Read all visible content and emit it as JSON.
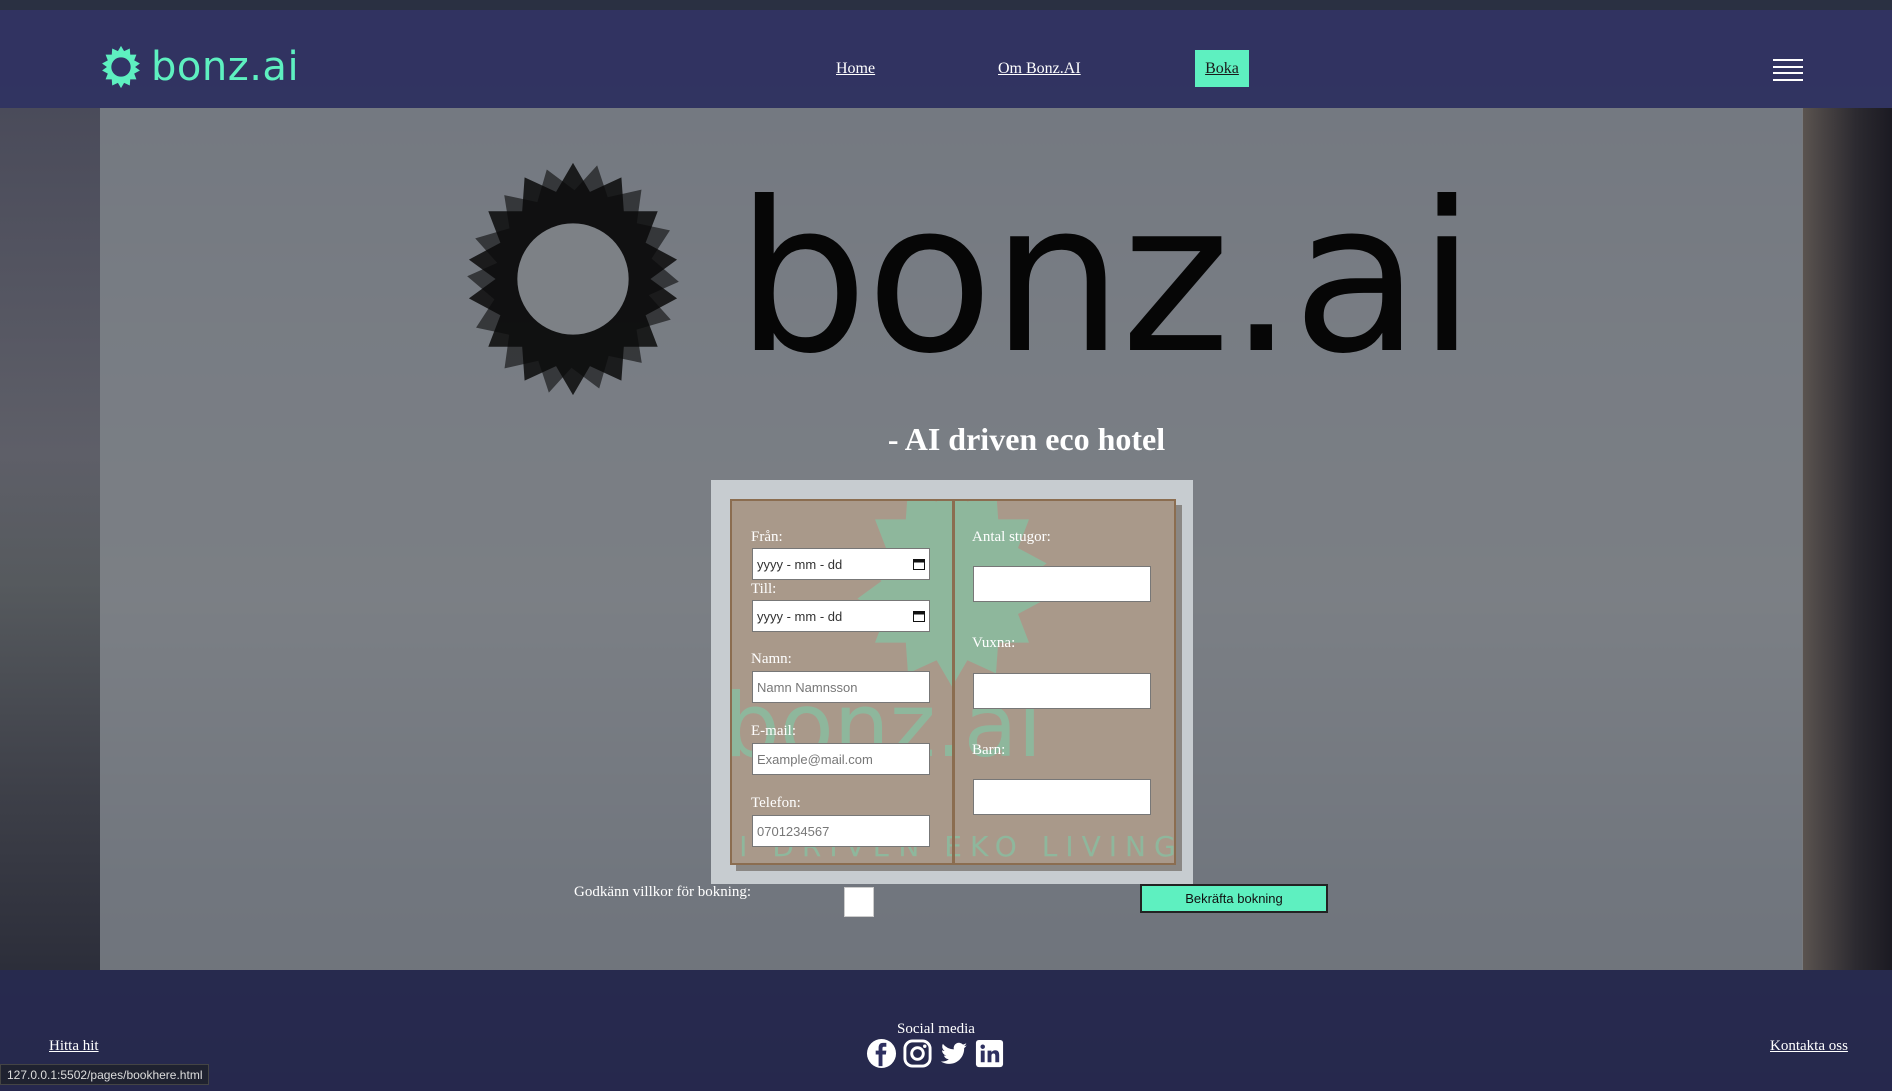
{
  "brand": {
    "name": "bonz.ai",
    "accent": "#5ef0c0"
  },
  "nav": {
    "home_label": "Home",
    "about_label": "Om Bonz.AI",
    "book_label": "Boka",
    "menu_icon": "hamburger-menu-icon"
  },
  "hero": {
    "big_logo_text": "bonz.ai",
    "subtitle": "- AI driven eco hotel",
    "watermark_brand": "bonz.ai",
    "watermark_tagline": "AI DRIVEN EKO LIVING"
  },
  "form": {
    "from_label": "Från:",
    "from_value": "yyyy - mm - dd",
    "to_label": "Till:",
    "to_value": "yyyy - mm - dd",
    "name_label": "Namn:",
    "name_placeholder": "Namn Namnsson",
    "email_label": "E-mail:",
    "email_placeholder": "Example@mail.com",
    "phone_label": "Telefon:",
    "phone_placeholder": "0701234567",
    "cabins_label": "Antal stugor:",
    "adults_label": "Vuxna:",
    "children_label": "Barn:",
    "terms_label": "Godkänn villkor för bokning:",
    "confirm_label": "Bekräfta bokning"
  },
  "footer": {
    "find_us_label": "Hitta hit",
    "social_title": "Social media",
    "social_icons": [
      "facebook-icon",
      "instagram-icon",
      "twitter-icon",
      "linkedin-icon"
    ],
    "contact_label": "Kontakta oss"
  },
  "status_bar": {
    "url": "127.0.0.1:5502/pages/bookhere.html"
  }
}
